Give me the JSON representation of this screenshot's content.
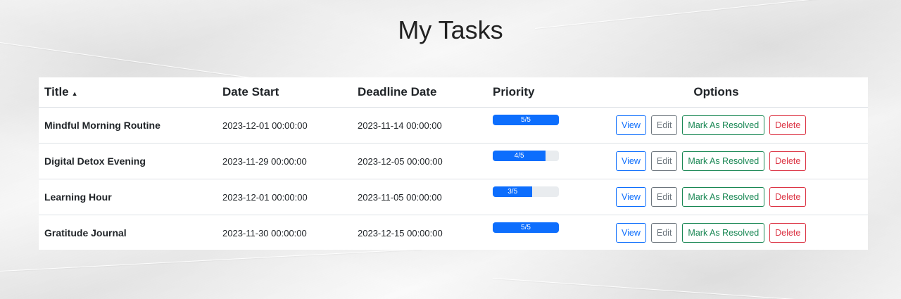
{
  "page": {
    "title": "My Tasks"
  },
  "table": {
    "headers": {
      "title": "Title",
      "sort_indicator": "▲",
      "date_start": "Date Start",
      "deadline": "Deadline Date",
      "priority": "Priority",
      "options": "Options"
    },
    "rows": [
      {
        "title": "Mindful Morning Routine",
        "date_start": "2023-12-01 00:00:00",
        "deadline": "2023-11-14 00:00:00",
        "priority_label": "5/5",
        "priority_value": 5,
        "priority_max": 5
      },
      {
        "title": "Digital Detox Evening",
        "date_start": "2023-11-29 00:00:00",
        "deadline": "2023-12-05 00:00:00",
        "priority_label": "4/5",
        "priority_value": 4,
        "priority_max": 5
      },
      {
        "title": "Learning Hour",
        "date_start": "2023-12-01 00:00:00",
        "deadline": "2023-11-05 00:00:00",
        "priority_label": "3/5",
        "priority_value": 3,
        "priority_max": 5
      },
      {
        "title": "Gratitude Journal",
        "date_start": "2023-11-30 00:00:00",
        "deadline": "2023-12-15 00:00:00",
        "priority_label": "5/5",
        "priority_value": 5,
        "priority_max": 5
      }
    ],
    "actions": {
      "view": "View",
      "edit": "Edit",
      "resolve": "Mark As Resolved",
      "delete": "Delete"
    }
  },
  "colors": {
    "primary": "#0d6efd",
    "secondary": "#6c757d",
    "success": "#198754",
    "danger": "#dc3545"
  }
}
